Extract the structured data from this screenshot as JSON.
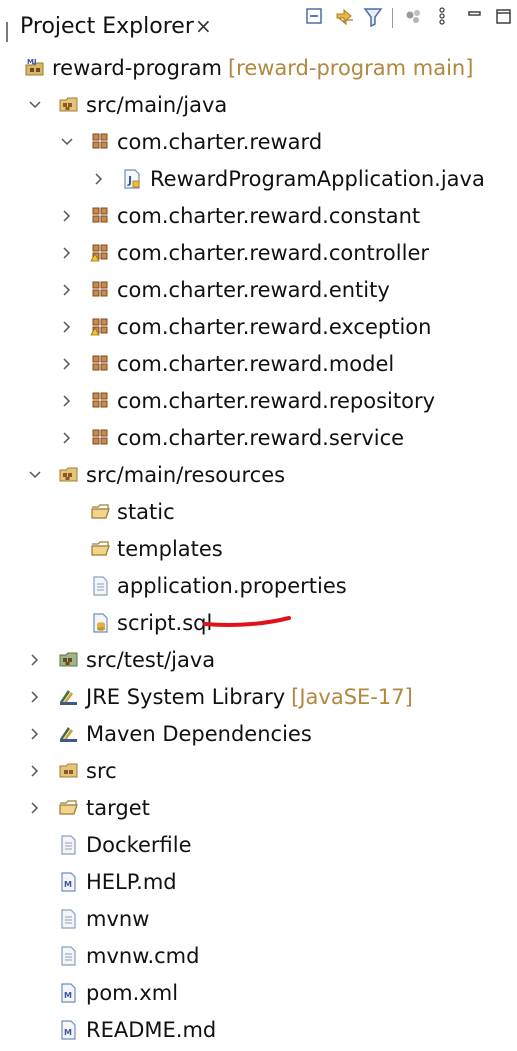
{
  "header": {
    "tab_title": "Project Explorer",
    "close_glyph": "×",
    "toolbar_icons": [
      "collapse-all-icon",
      "link-with-editor-icon",
      "filter-icon",
      "focus-icon",
      "view-menu-icon",
      "minimize-icon",
      "maximize-icon"
    ]
  },
  "tree": {
    "project": {
      "label": "reward-program",
      "decoration": "[reward-program main]"
    },
    "src_main_java": {
      "label": "src/main/java"
    },
    "pkg_reward": {
      "label": "com.charter.reward"
    },
    "app_java": {
      "label": "RewardProgramApplication.java"
    },
    "pkg_constant": {
      "label": "com.charter.reward.constant"
    },
    "pkg_controller": {
      "label": "com.charter.reward.controller"
    },
    "pkg_entity": {
      "label": "com.charter.reward.entity"
    },
    "pkg_exception": {
      "label": "com.charter.reward.exception"
    },
    "pkg_model": {
      "label": "com.charter.reward.model"
    },
    "pkg_repository": {
      "label": "com.charter.reward.repository"
    },
    "pkg_service": {
      "label": "com.charter.reward.service"
    },
    "src_main_resources": {
      "label": "src/main/resources"
    },
    "static": {
      "label": "static"
    },
    "templates": {
      "label": "templates"
    },
    "app_props": {
      "label": "application.properties"
    },
    "script_sql": {
      "label": "script.sql"
    },
    "src_test_java": {
      "label": "src/test/java"
    },
    "jre": {
      "label": "JRE System Library",
      "decoration": "[JavaSE-17]"
    },
    "maven_deps": {
      "label": "Maven Dependencies"
    },
    "src": {
      "label": "src"
    },
    "target": {
      "label": "target"
    },
    "dockerfile": {
      "label": "Dockerfile"
    },
    "help_md": {
      "label": "HELP.md"
    },
    "mvnw": {
      "label": "mvnw"
    },
    "mvnw_cmd": {
      "label": "mvnw.cmd"
    },
    "pom_xml": {
      "label": "pom.xml"
    },
    "readme_md": {
      "label": "README.md"
    }
  },
  "colors": {
    "decoration": "#b0883e",
    "annotation": "#e0121b",
    "package_brown": "#8a5a2b",
    "folder_tan": "#c9a45a"
  }
}
